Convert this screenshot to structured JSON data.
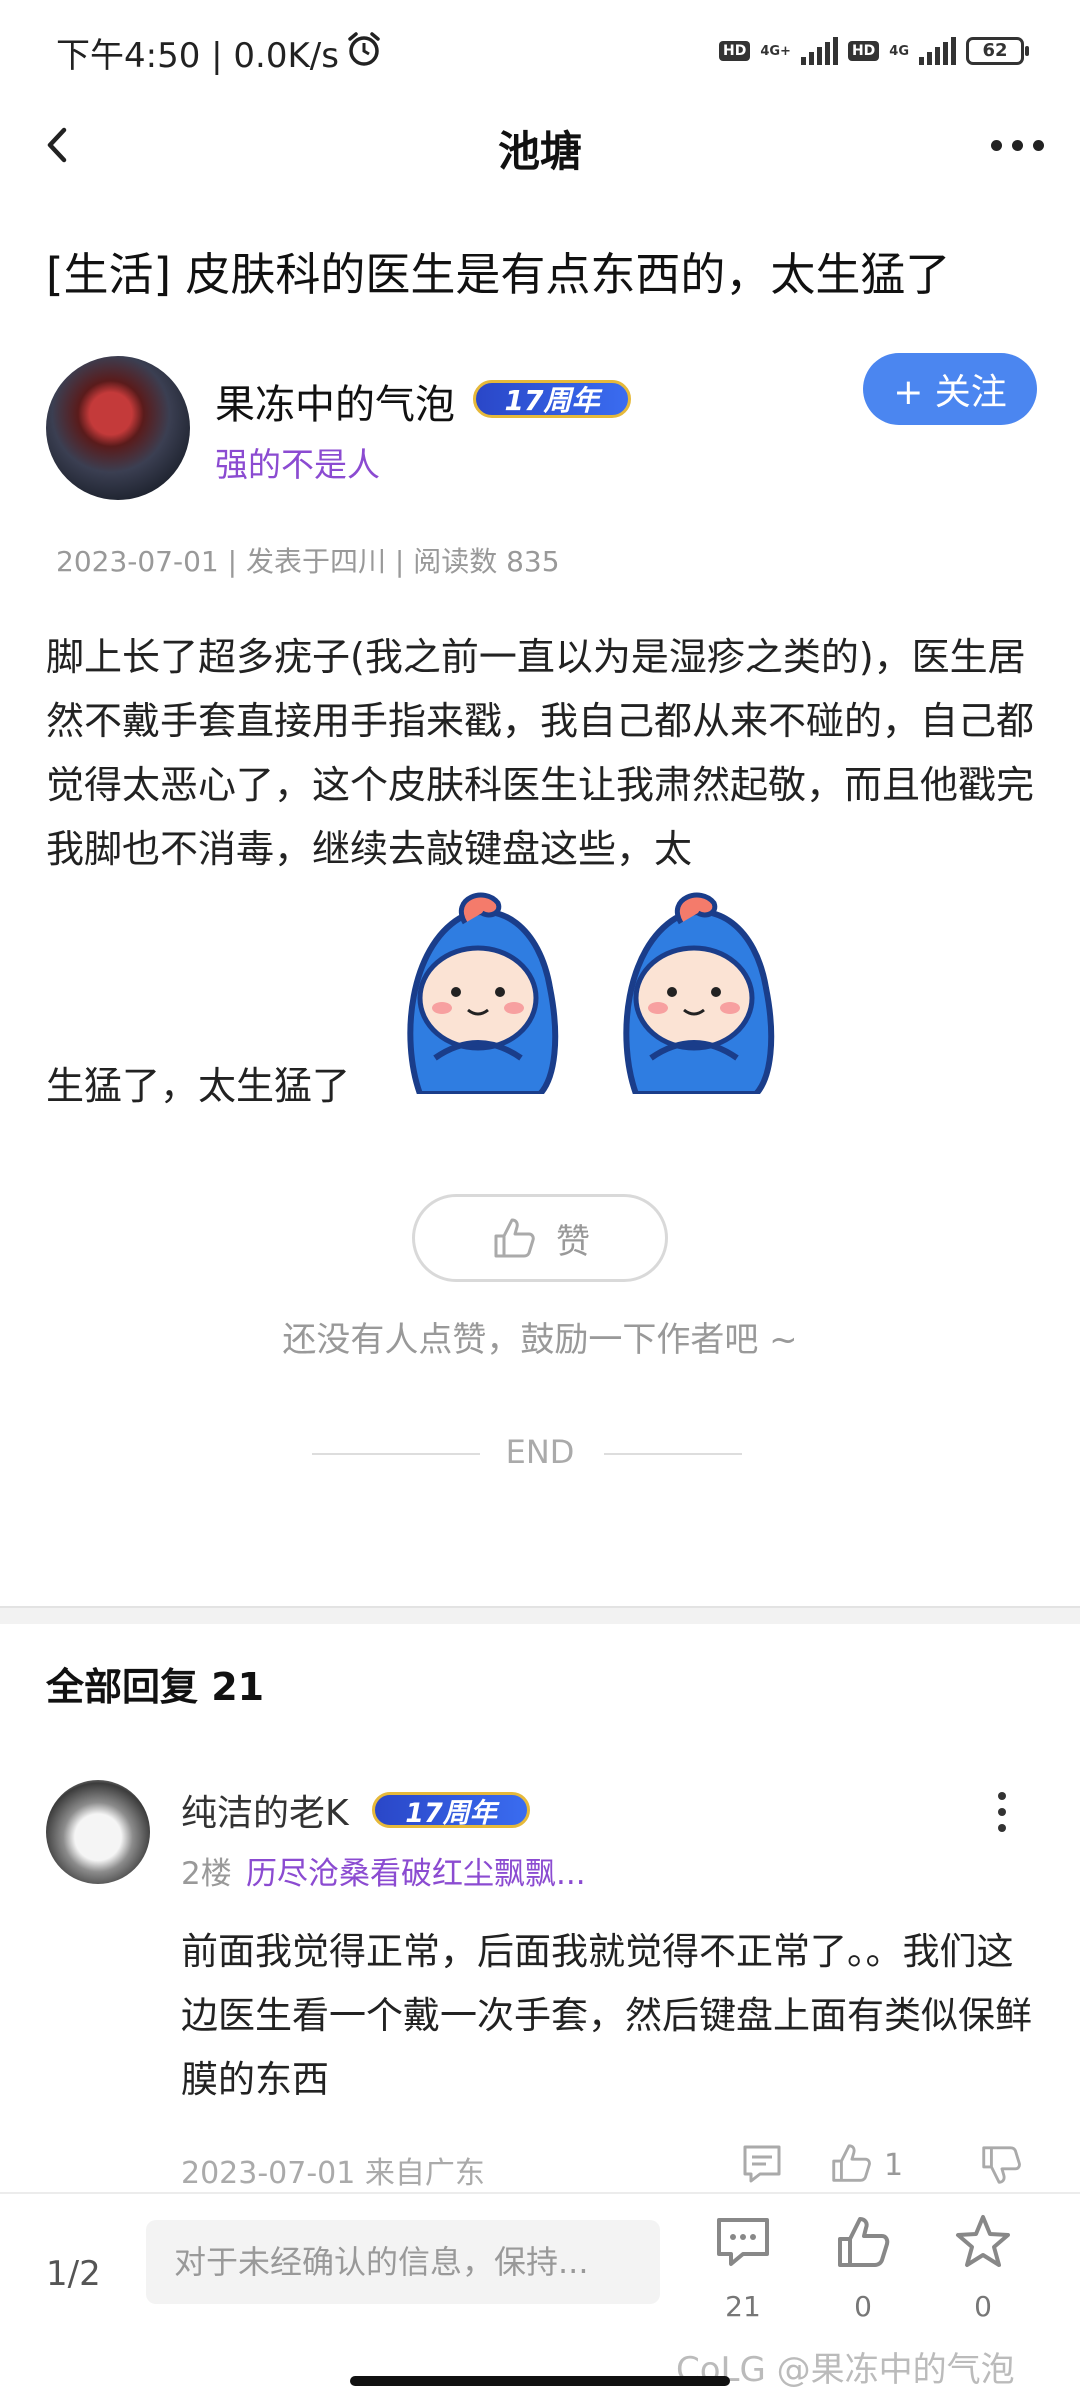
{
  "status_bar": {
    "left_text": "下午4:50 | 0.0K/s",
    "sim1_hd": "HD",
    "sim1_net": "4G+",
    "sim2_hd": "HD",
    "sim2_net": "4G",
    "battery": "62"
  },
  "nav": {
    "title": "池塘"
  },
  "post": {
    "title": "[生活] 皮肤科的医生是有点东西的，太生猛了",
    "author": {
      "name": "果冻中的气泡",
      "badge": "17周年",
      "signature": "强的不是人"
    },
    "follow_label": "+ 关注",
    "meta": "2023-07-01 | 发表于四川 | 阅读数 835",
    "body": "脚上长了超多疣子(我之前一直以为是湿疹之类的)，医生居然不戴手套直接用手指来戳，我自己都从来不碰的，自己都觉得太恶心了，这个皮肤科医生让我肃然起敬，而且他戳完我脚也不消毒，继续去敲键盘这些，太",
    "body_end": "生猛了，太生猛了",
    "like_label": "赞",
    "like_hint": "还没有人点赞，鼓励一下作者吧 ~",
    "end_text": "END"
  },
  "replies": {
    "header": "全部回复  21",
    "items": [
      {
        "name": "纯洁的老K",
        "badge": "17周年",
        "floor": "2楼",
        "signature": "历尽沧桑看破红尘飘飘...",
        "text": "前面我觉得正常，后面我就觉得不正常了。。我们这边医生看一个戴一次手套，然后键盘上面有类似保鲜膜的东西",
        "meta": "2023-07-01 来自广东",
        "likes": "1"
      }
    ]
  },
  "bottom_bar": {
    "page_indicator": "1/2",
    "input_placeholder": "对于未经确认的信息，保持...",
    "comment_count": "21",
    "like_count": "0",
    "star_count": "0",
    "watermark": "CoLG @果冻中的气泡"
  },
  "icons": {
    "back": "chevron-left-icon",
    "more": "more-horizontal-icon",
    "alarm": "alarm-clock-icon",
    "like": "thumbs-up-icon",
    "dislike": "thumbs-down-icon",
    "comment": "comment-icon",
    "star": "star-icon"
  },
  "colors": {
    "accent_blue": "#4b86f0",
    "signature_purple": "#8b4bd1",
    "muted_gray": "#999999"
  }
}
